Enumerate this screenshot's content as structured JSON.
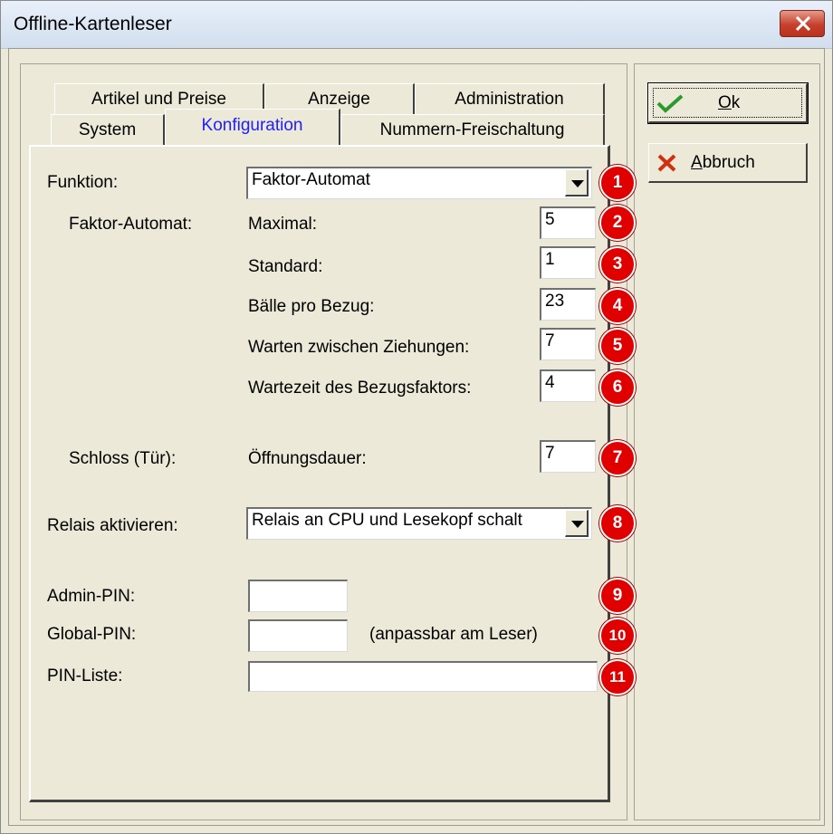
{
  "window": {
    "title": "Offline-Kartenleser"
  },
  "tabs": {
    "row1": [
      "Artikel und Preise",
      "Anzeige",
      "Administration"
    ],
    "row2": [
      "System",
      "Konfiguration",
      "Nummern-Freischaltung"
    ],
    "active": "Konfiguration"
  },
  "buttons": {
    "ok": {
      "underline": "O",
      "rest": "k"
    },
    "cancel": {
      "underline": "A",
      "rest": "bbruch"
    }
  },
  "form": {
    "funktion_label": "Funktion:",
    "funktion_value": "Faktor-Automat",
    "faktor_group_label": "Faktor-Automat:",
    "maximal_label": "Maximal:",
    "maximal_value": "5",
    "standard_label": "Standard:",
    "standard_value": "1",
    "baelle_label": "Bälle pro Bezug:",
    "baelle_value": "23",
    "warten_label": "Warten zwischen Ziehungen:",
    "warten_value": "7",
    "wartezeit_label": "Wartezeit des Bezugsfaktors:",
    "wartezeit_value": "4",
    "schloss_label": "Schloss (Tür):",
    "oeffnung_label": "Öffnungsdauer:",
    "oeffnung_value": "7",
    "relais_label": "Relais aktivieren:",
    "relais_value": "Relais an CPU und Lesekopf schalt",
    "admin_pin_label": "Admin-PIN:",
    "admin_pin_value": "",
    "global_pin_label": "Global-PIN:",
    "global_pin_value": "",
    "global_pin_hint": "(anpassbar am Leser)",
    "pin_liste_label": "PIN-Liste:",
    "pin_liste_value": ""
  },
  "badges": [
    "1",
    "2",
    "3",
    "4",
    "5",
    "6",
    "7",
    "8",
    "9",
    "10",
    "11"
  ],
  "colors": {
    "badge": "#e00000",
    "active_tab_text": "#2020ff",
    "ok_check": "#2a9a2a",
    "cancel_x": "#d03010"
  }
}
